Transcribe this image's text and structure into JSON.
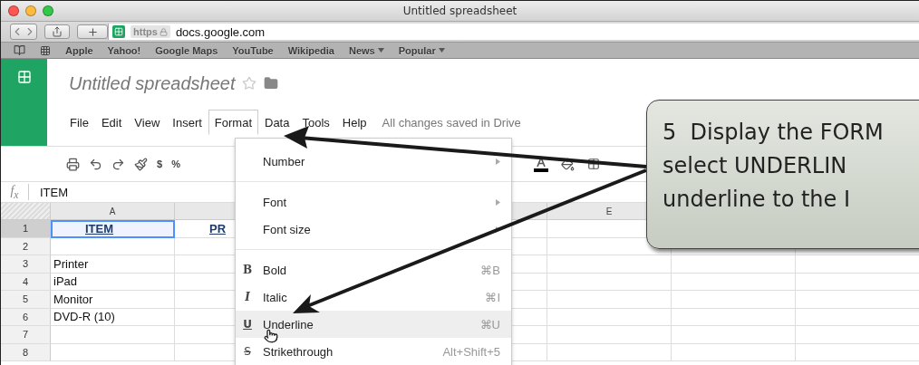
{
  "window": {
    "title": "Untitled spreadsheet"
  },
  "browser": {
    "scheme": "https",
    "url": "docs.google.com",
    "bookmarks": [
      {
        "label": "Apple",
        "dropdown": false
      },
      {
        "label": "Yahoo!",
        "dropdown": false
      },
      {
        "label": "Google Maps",
        "dropdown": false
      },
      {
        "label": "YouTube",
        "dropdown": false
      },
      {
        "label": "Wikipedia",
        "dropdown": false
      },
      {
        "label": "News",
        "dropdown": true
      },
      {
        "label": "Popular",
        "dropdown": true
      }
    ]
  },
  "doc": {
    "title": "Untitled spreadsheet",
    "menus": [
      {
        "label": "File",
        "selected": false
      },
      {
        "label": "Edit",
        "selected": false
      },
      {
        "label": "View",
        "selected": false
      },
      {
        "label": "Insert",
        "selected": false
      },
      {
        "label": "Format",
        "selected": true
      },
      {
        "label": "Data",
        "selected": false
      },
      {
        "label": "Tools",
        "selected": false
      },
      {
        "label": "Help",
        "selected": false
      }
    ],
    "save_status": "All changes saved in Drive"
  },
  "toolbar": {
    "currency": "$",
    "percent": "%"
  },
  "formula_bar": {
    "label": "f$_{x}$",
    "value": "ITEM"
  },
  "grid": {
    "columns": [
      {
        "label": "A"
      },
      {},
      {},
      {},
      {
        "label": "E"
      },
      {},
      {}
    ],
    "rows": [
      {
        "number": "1",
        "selected": true,
        "header": true,
        "cells": [
          {
            "text": "ITEM",
            "selected": true
          },
          {
            "text": "PR",
            "selected": false
          }
        ]
      },
      {
        "number": "2",
        "selected": false,
        "cells": []
      },
      {
        "number": "3",
        "selected": false,
        "header": false,
        "cells": [
          {
            "text": "Printer",
            "selected": false
          }
        ]
      },
      {
        "number": "4",
        "selected": false,
        "header": false,
        "cells": [
          {
            "text": "iPad",
            "selected": false
          }
        ]
      },
      {
        "number": "5",
        "selected": false,
        "header": false,
        "cells": [
          {
            "text": "Monitor",
            "selected": false
          }
        ]
      },
      {
        "number": "6",
        "selected": false,
        "header": false,
        "cells": [
          {
            "text": "DVD-R (10)",
            "selected": false
          }
        ]
      },
      {
        "number": "7",
        "selected": false,
        "cells": []
      },
      {
        "number": "8",
        "selected": false,
        "cells": []
      }
    ]
  },
  "format_menu": {
    "items": [
      {
        "kind": "submenu",
        "label": "Number",
        "selected": false
      },
      {
        "kind": "separator"
      },
      {
        "kind": "submenu",
        "label": "Font",
        "selected": false
      },
      {
        "kind": "submenu",
        "label": "Font size",
        "selected": false
      },
      {
        "kind": "separator"
      },
      {
        "kind": "command",
        "glyph": {
          "text": "B",
          "kind": "bold"
        },
        "label": "Bold",
        "shortcut": "⌘B",
        "selected": false
      },
      {
        "kind": "command",
        "glyph": {
          "text": "I",
          "kind": "italic"
        },
        "label": "Italic",
        "shortcut": "⌘I",
        "selected": false
      },
      {
        "kind": "command",
        "glyph": {
          "text": "U",
          "kind": "underline"
        },
        "label": "Underline",
        "shortcut": "⌘U",
        "selected": true
      },
      {
        "kind": "command",
        "glyph": {
          "text": "S",
          "kind": "strike"
        },
        "label": "Strikethrough",
        "shortcut": "Alt+Shift+5",
        "selected": false
      }
    ]
  },
  "callout": {
    "step": "5",
    "lines": [
      "Display the FORM",
      "select UNDERLIN",
      "underline to the I"
    ]
  }
}
